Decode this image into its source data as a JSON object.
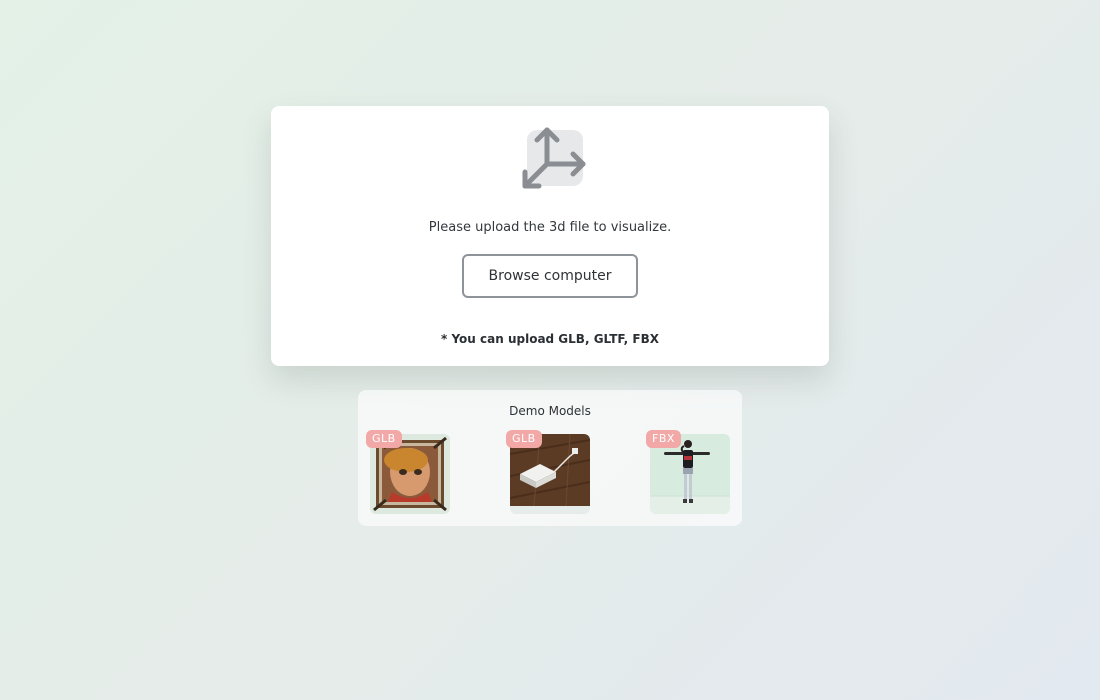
{
  "upload": {
    "icon": "3d-axis-icon",
    "prompt": "Please upload the 3d file to visualize.",
    "browse_label": "Browse computer",
    "formats_note": "* You can upload GLB, GLTF, FBX"
  },
  "demo": {
    "title": "Demo Models",
    "items": [
      {
        "format": "GLB",
        "thumbnail": "portrait-frame-model"
      },
      {
        "format": "GLB",
        "thumbnail": "device-on-wood-floor-model"
      },
      {
        "format": "FBX",
        "thumbnail": "t-pose-character-model"
      }
    ]
  },
  "colors": {
    "badge": "#f3a8a8",
    "button_border": "#8e9399",
    "icon_gray": "#8a8e93"
  }
}
